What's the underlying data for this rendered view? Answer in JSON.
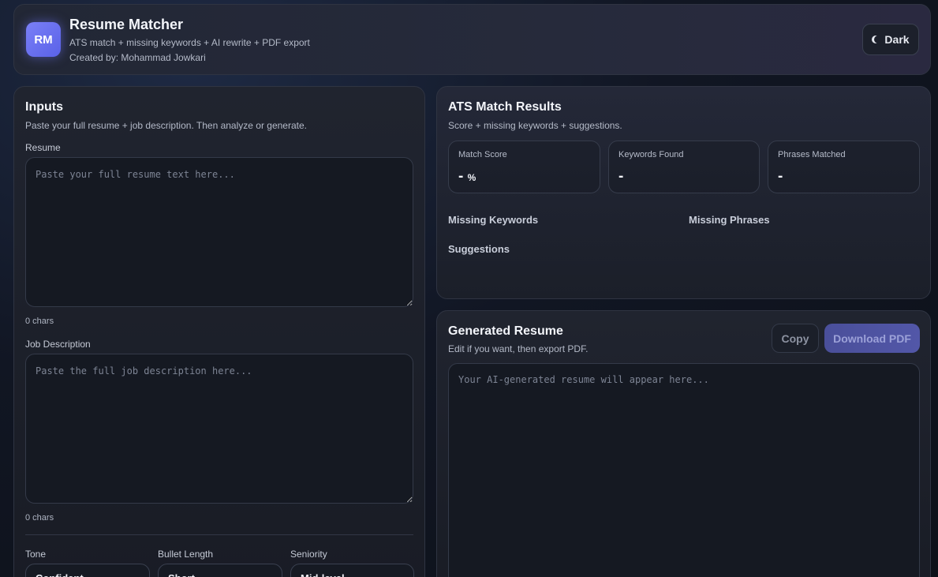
{
  "header": {
    "logo": "RM",
    "title": "Resume Matcher",
    "subtitle": "ATS match + missing keywords + AI rewrite + PDF export",
    "credit": "Created by: Mohammad Jowkari",
    "theme_label": "Dark",
    "theme_icon": "moon-icon"
  },
  "inputs": {
    "title": "Inputs",
    "subtitle": "Paste your full resume + job description. Then analyze or generate.",
    "resume_label": "Resume",
    "resume_placeholder": "Paste your full resume text here...",
    "resume_count": "0 chars",
    "jd_label": "Job Description",
    "jd_placeholder": "Paste the full job description here...",
    "jd_count": "0 chars",
    "tone_label": "Tone",
    "tone_value": "Confident",
    "bullet_label": "Bullet Length",
    "bullet_value": "Short",
    "seniority_label": "Seniority",
    "seniority_value": "Mid-level"
  },
  "ats": {
    "title": "ATS Match Results",
    "subtitle": "Score + missing keywords + suggestions.",
    "stats": [
      {
        "label": "Match Score",
        "value": "-",
        "unit": "%"
      },
      {
        "label": "Keywords Found",
        "value": "-"
      },
      {
        "label": "Phrases Matched",
        "value": "-"
      }
    ],
    "missing_keywords": "Missing Keywords",
    "missing_phrases": "Missing Phrases",
    "suggestions": "Suggestions"
  },
  "generated": {
    "title": "Generated Resume",
    "subtitle": "Edit if you want, then export PDF.",
    "copy_label": "Copy",
    "pdf_label": "Download PDF",
    "placeholder": "Your AI-generated resume will appear here..."
  }
}
